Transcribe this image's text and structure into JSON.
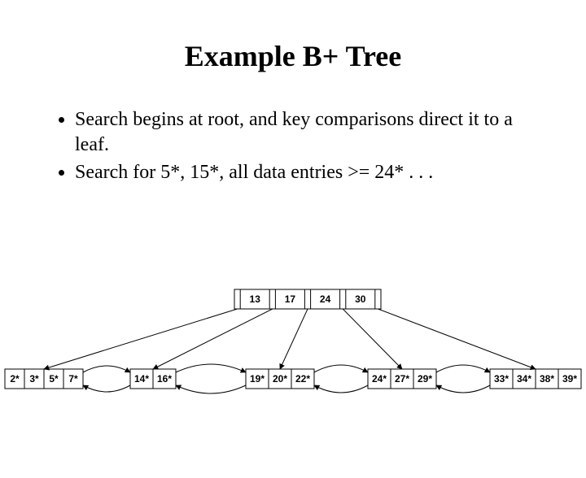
{
  "title": "Example B+ Tree",
  "bullets": [
    "Search begins at root, and key comparisons direct it to a leaf.",
    "Search for 5*, 15*, all data entries >= 24* . . ."
  ],
  "chart_data": {
    "type": "tree",
    "title": "B+ Tree example",
    "root": {
      "keys": [
        "13",
        "17",
        "24",
        "30"
      ]
    },
    "leaves": [
      {
        "entries": [
          "2*",
          "3*",
          "5*",
          "7*"
        ]
      },
      {
        "entries": [
          "14*",
          "16*"
        ]
      },
      {
        "entries": [
          "19*",
          "20*",
          "22*"
        ]
      },
      {
        "entries": [
          "24*",
          "27*",
          "29*"
        ]
      },
      {
        "entries": [
          "33*",
          "34*",
          "38*",
          "39*"
        ]
      }
    ],
    "edges": [
      {
        "from": "root.ptr0",
        "to": "leaf0"
      },
      {
        "from": "root.ptr1",
        "to": "leaf1"
      },
      {
        "from": "root.ptr2",
        "to": "leaf2"
      },
      {
        "from": "root.ptr3",
        "to": "leaf3"
      },
      {
        "from": "root.ptr4",
        "to": "leaf4"
      }
    ],
    "sibling_links": [
      [
        "leaf0",
        "leaf1"
      ],
      [
        "leaf1",
        "leaf2"
      ],
      [
        "leaf2",
        "leaf3"
      ],
      [
        "leaf3",
        "leaf4"
      ]
    ]
  }
}
